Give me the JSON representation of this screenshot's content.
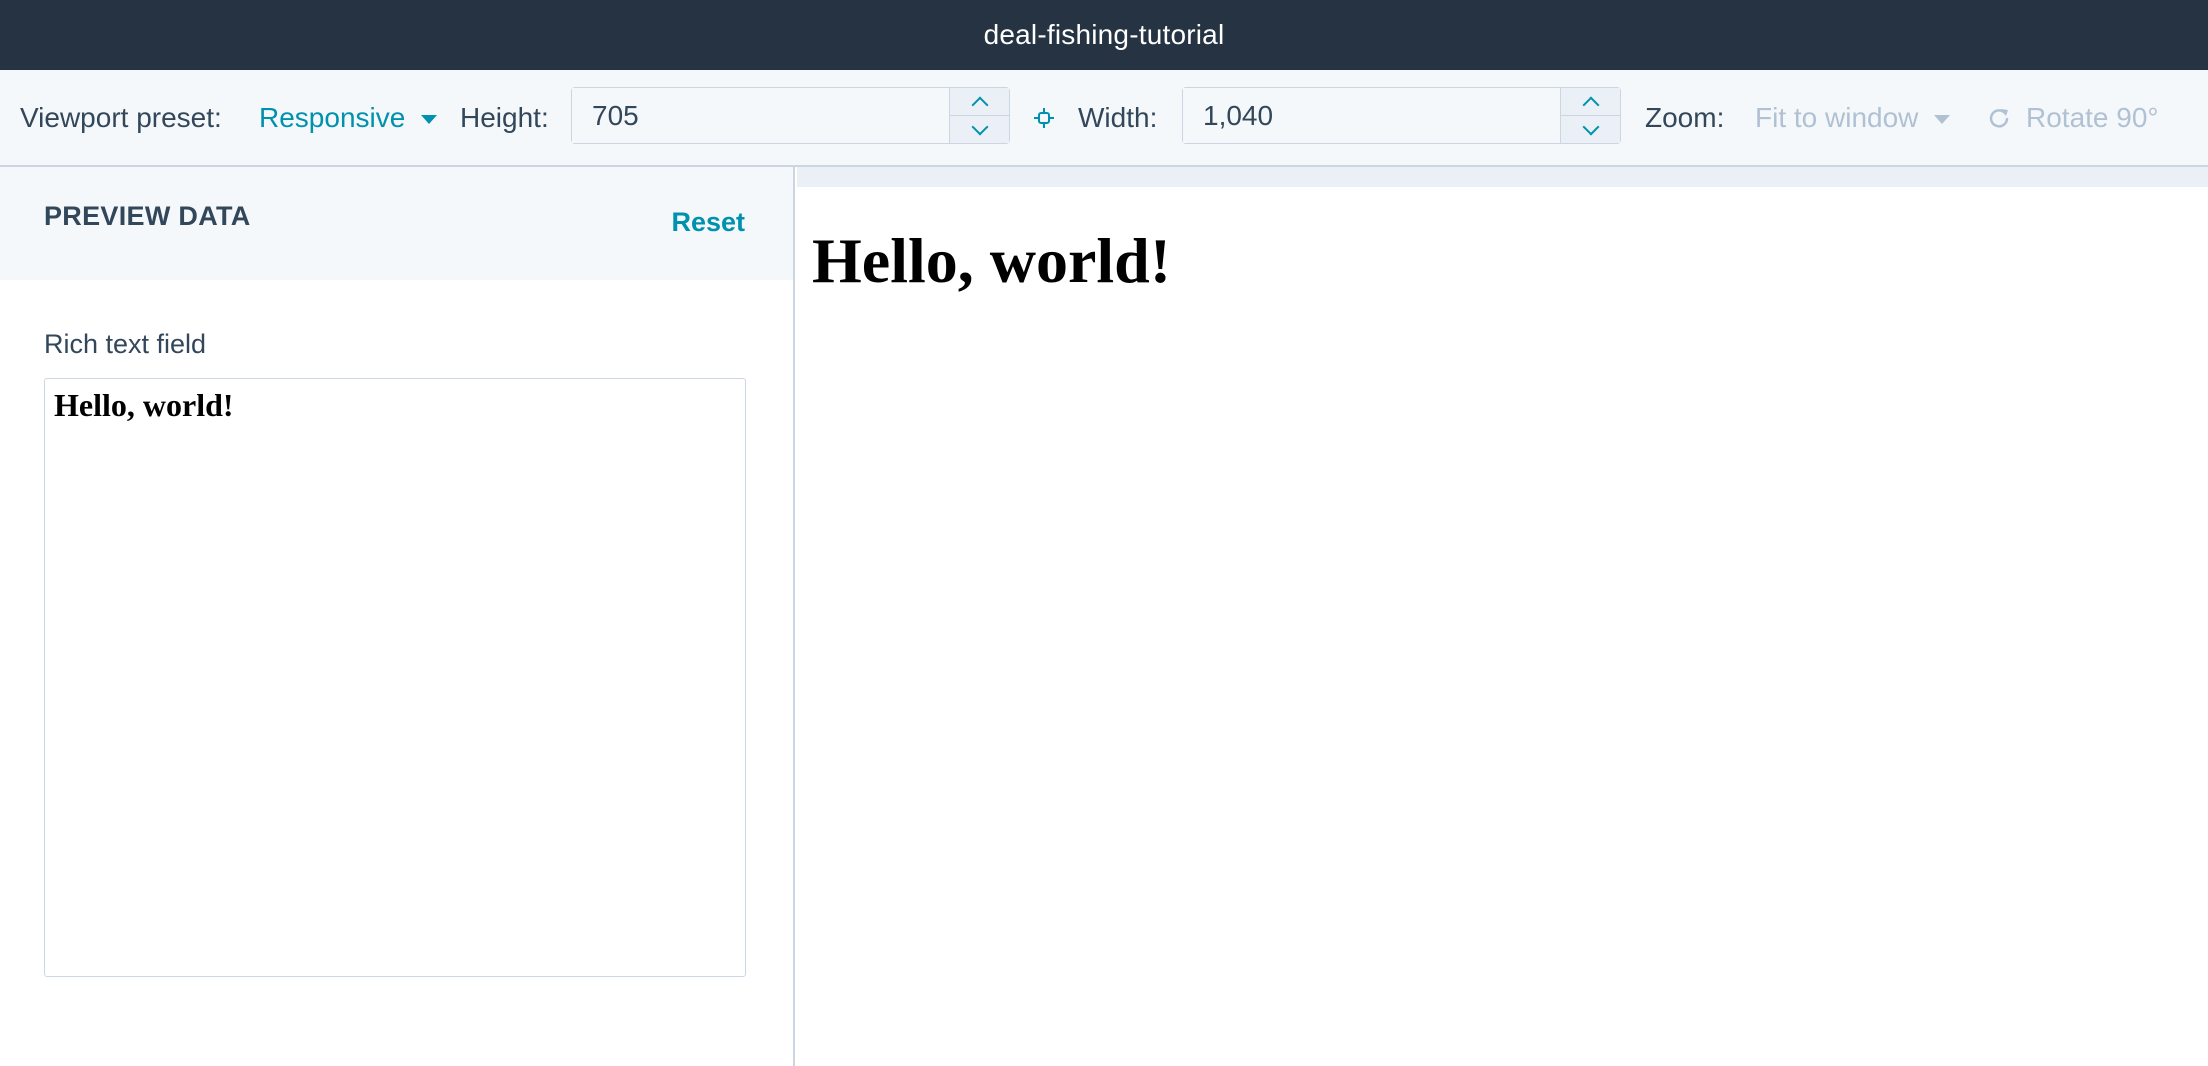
{
  "window": {
    "title": "deal-fishing-tutorial"
  },
  "toolbar": {
    "viewport_preset_label": "Viewport preset:",
    "viewport_preset_value": "Responsive",
    "height_label": "Height:",
    "height_value": "705",
    "width_label": "Width:",
    "width_value": "1,040",
    "zoom_label": "Zoom:",
    "zoom_value": "Fit to window",
    "rotate_label": "Rotate 90°",
    "icons": {
      "link": "link-dimensions-icon",
      "rotate": "rotate-icon",
      "increment": "chevron-up-icon",
      "decrement": "chevron-down-icon",
      "dropdown": "caret-down-icon"
    }
  },
  "sidebar": {
    "heading": "PREVIEW DATA",
    "reset_label": "Reset",
    "field_label": "Rich text field",
    "field_value": "Hello, world!"
  },
  "preview": {
    "heading": "Hello, world!"
  },
  "colors": {
    "titlebar_bg": "#253342",
    "accent": "#0091ae",
    "text": "#33475b",
    "disabled": "#b0c1d4",
    "border": "#cbd6e2",
    "panel_bg": "#f5f8fa"
  }
}
